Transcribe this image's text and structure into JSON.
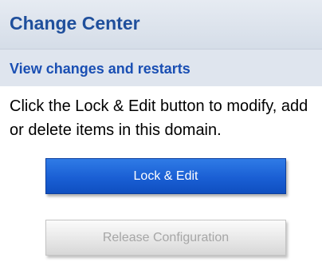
{
  "panel": {
    "title": "Change Center"
  },
  "section": {
    "title": "View changes and restarts",
    "description": "Click the Lock & Edit button to modify, add or delete items in this domain."
  },
  "buttons": {
    "lock_edit_label": "Lock & Edit",
    "release_label": "Release Configuration",
    "release_enabled": false
  },
  "colors": {
    "title": "#1f4f9c",
    "subtitle": "#1a4fb3",
    "primary_button": "#1a5fd4",
    "disabled_text": "#a6a6a6"
  }
}
